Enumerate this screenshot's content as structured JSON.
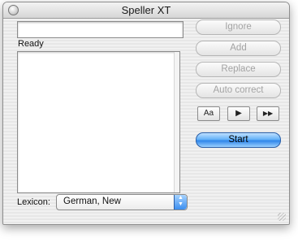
{
  "window": {
    "title": "Speller XT"
  },
  "status": {
    "text": "Ready"
  },
  "word_input": {
    "value": ""
  },
  "buttons": {
    "ignore": "Ignore",
    "add": "Add",
    "replace": "Replace",
    "auto_correct": "Auto correct",
    "start": "Start"
  },
  "mini_buttons": {
    "case": "Aa",
    "play": "▶",
    "fast_forward": "▶▶"
  },
  "lexicon": {
    "label": "Lexicon:",
    "selected": "German, New"
  },
  "colors": {
    "accent": "#3b8ef0",
    "disabled_text": "#a3a3a3"
  }
}
